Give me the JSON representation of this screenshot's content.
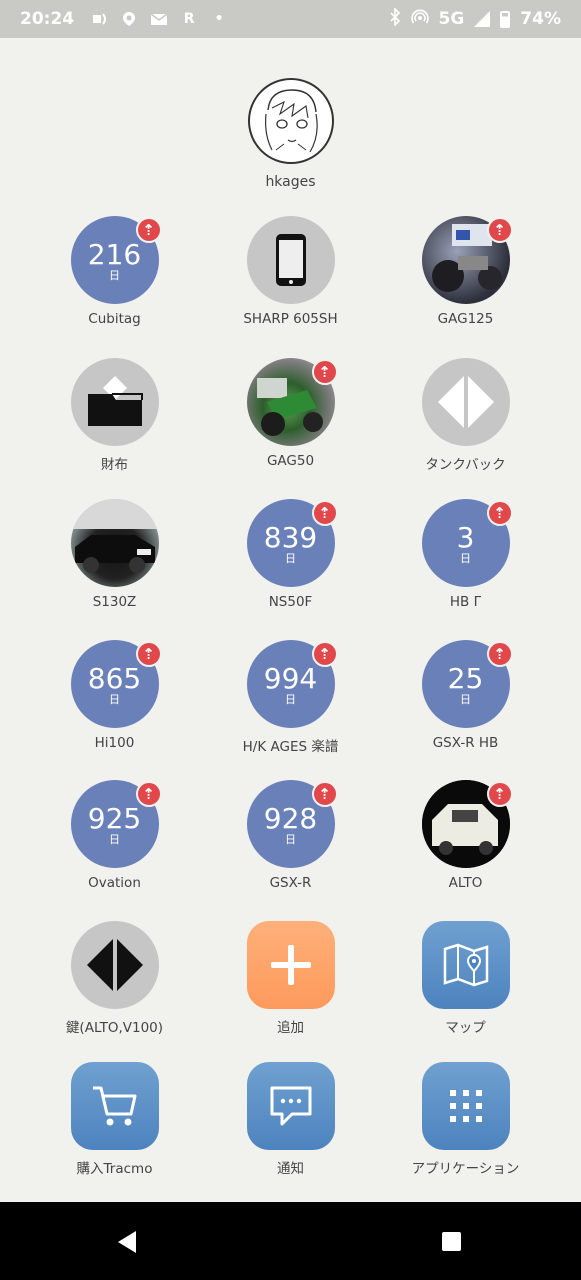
{
  "status_bar": {
    "time": "20:24",
    "left_icons": [
      "broadcast-icon",
      "location-icon",
      "mail-icon",
      "rakuten-icon",
      "dot-icon"
    ],
    "rakuten_glyph": "R",
    "dot_glyph": "•",
    "network": "5G",
    "battery": "74%"
  },
  "profile": {
    "name": "hkages"
  },
  "items": [
    {
      "label": "Cubitag",
      "days": "216",
      "unit": "日",
      "badge": true,
      "style": "blue"
    },
    {
      "label": "SHARP 605SH",
      "icon": "phone-icon",
      "badge": false,
      "style": "grey"
    },
    {
      "label": "GAG125",
      "badge": true,
      "style": "photo-dark"
    },
    {
      "label": "財布",
      "icon": "wallet-icon",
      "badge": false,
      "style": "grey"
    },
    {
      "label": "GAG50",
      "badge": true,
      "style": "photo-green"
    },
    {
      "label": "タンクバック",
      "icon": "tag-diamond-icon",
      "badge": false,
      "style": "grey"
    },
    {
      "label": "S130Z",
      "badge": false,
      "style": "photo-car"
    },
    {
      "label": "NS50F",
      "days": "839",
      "unit": "日",
      "badge": true,
      "style": "blue"
    },
    {
      "label": "HB Γ",
      "days": "3",
      "unit": "日",
      "badge": true,
      "style": "blue"
    },
    {
      "label": "Hi100",
      "days": "865",
      "unit": "日",
      "badge": true,
      "style": "blue"
    },
    {
      "label": "H/K AGES 楽譜",
      "days": "994",
      "unit": "日",
      "badge": true,
      "style": "blue"
    },
    {
      "label": "GSX-R HB",
      "days": "25",
      "unit": "日",
      "badge": true,
      "style": "blue"
    },
    {
      "label": "Ovation",
      "days": "925",
      "unit": "日",
      "badge": true,
      "style": "blue"
    },
    {
      "label": "GSX-R",
      "days": "928",
      "unit": "日",
      "badge": true,
      "style": "blue"
    },
    {
      "label": "ALTO",
      "badge": true,
      "style": "photo-alto"
    },
    {
      "label": "鍵(ALTO,V100)",
      "icon": "tag-diamond-dark-icon",
      "badge": false,
      "style": "grey"
    }
  ],
  "actions": {
    "add": {
      "label": "追加",
      "icon": "plus-icon"
    },
    "map": {
      "label": "マップ",
      "icon": "map-icon"
    },
    "buy": {
      "label": "購入Tracmo",
      "icon": "cart-icon"
    },
    "notify": {
      "label": "通知",
      "icon": "chat-icon"
    },
    "apps": {
      "label": "アプリケーション",
      "icon": "grid-icon"
    }
  },
  "badge_icon": "upload-arrow-icon",
  "nav_bar": {
    "back": "back-icon",
    "recents": "recents-icon"
  }
}
